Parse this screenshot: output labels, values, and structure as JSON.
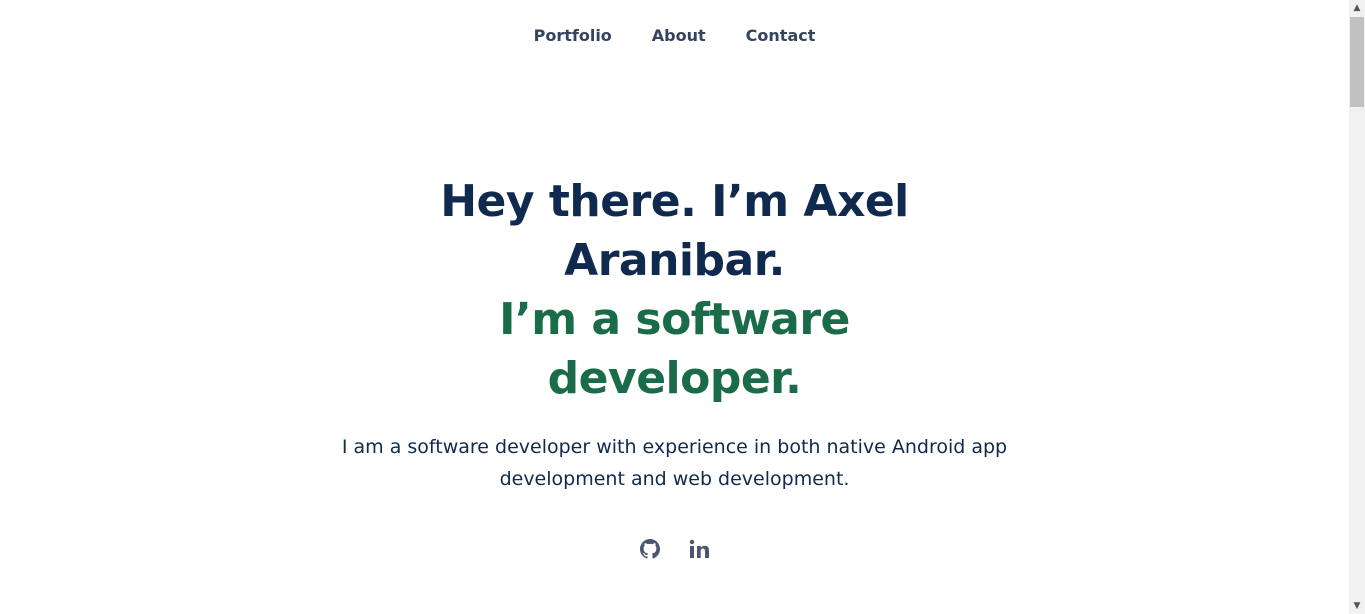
{
  "nav": {
    "items": [
      {
        "label": "Portfolio"
      },
      {
        "label": "About"
      },
      {
        "label": "Contact"
      }
    ]
  },
  "hero": {
    "line1": "Hey there. I’m Axel Aranibar.",
    "line2": "I’m a software developer.",
    "description": "I am a software developer with experience in both native Android app development and web development."
  },
  "socials": [
    {
      "icon": "github-icon"
    },
    {
      "icon": "linkedin-icon"
    }
  ],
  "colors": {
    "nav_text": "#34435e",
    "heading_dark": "#0f2a4e",
    "heading_green": "#1a6b48",
    "icon": "#4b5670"
  },
  "scrollbar": {
    "up_arrow": "▲",
    "down_arrow": "▼"
  }
}
